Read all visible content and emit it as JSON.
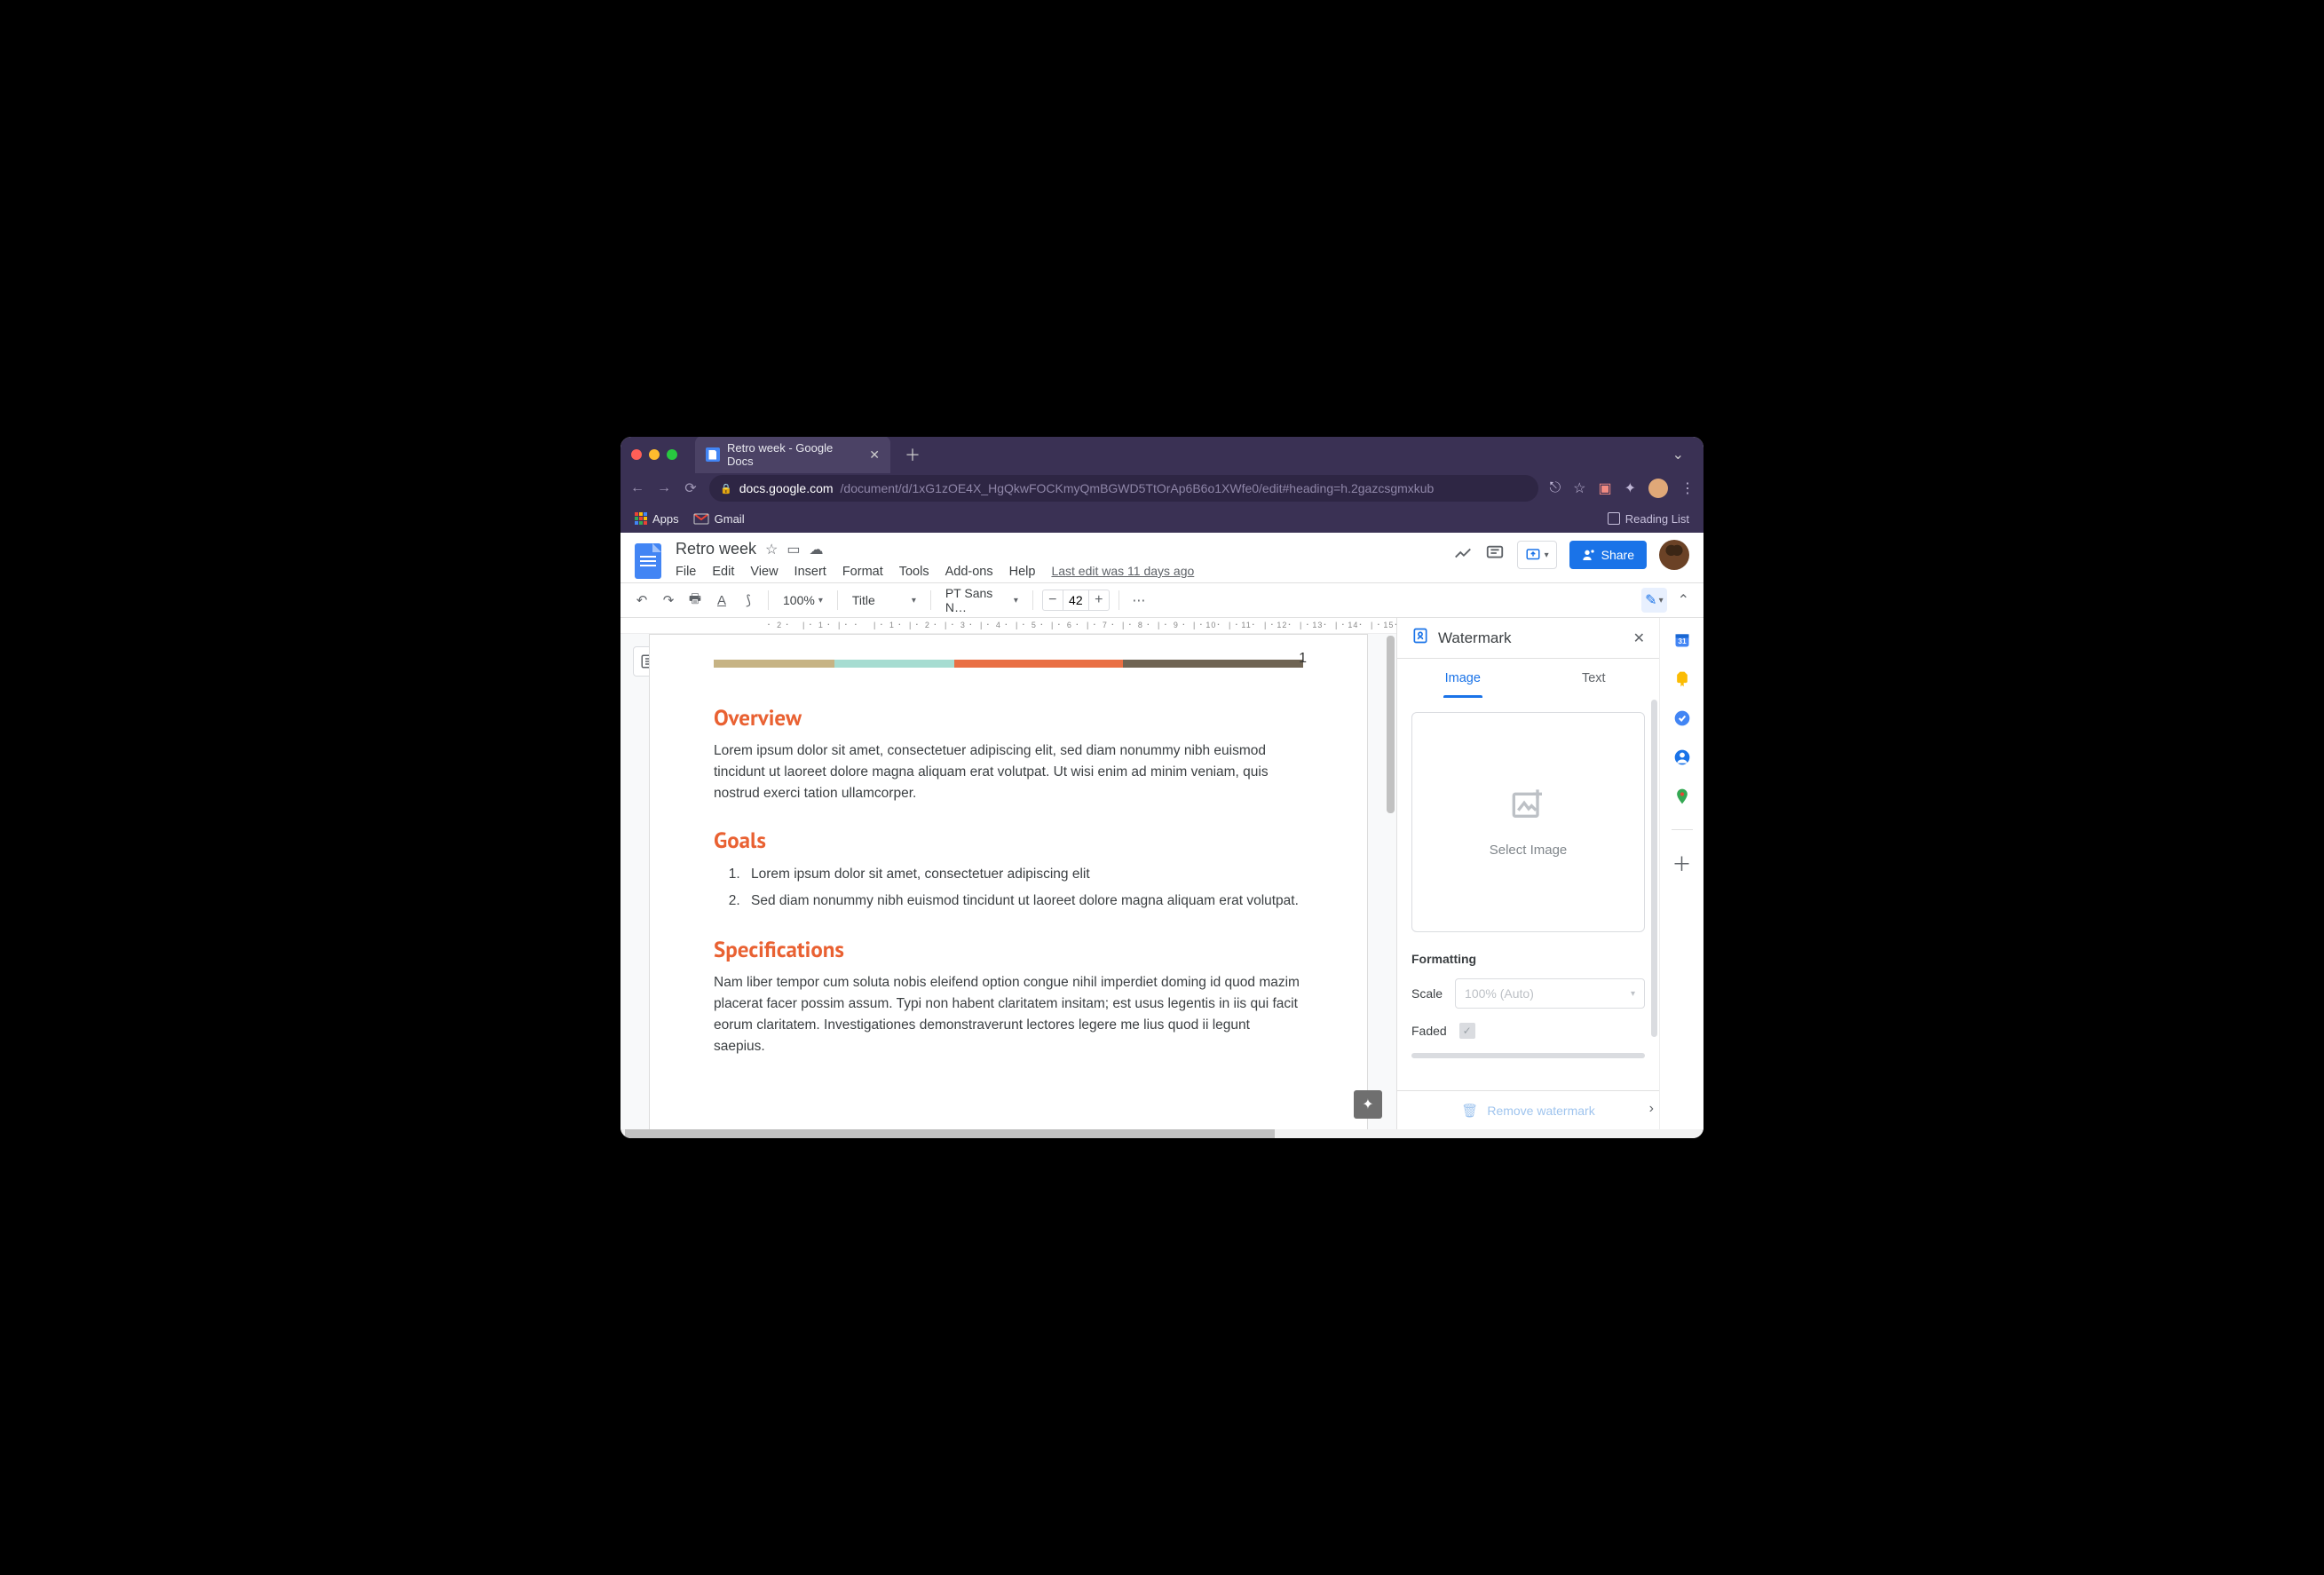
{
  "browser": {
    "tab_title": "Retro week - Google Docs",
    "url_host": "docs.google.com",
    "url_path": "/document/d/1xG1zOE4X_HgQkwFOCKmyQmBGWD5TtOrAp6B6o1XWfe0/edit#heading=h.2gazcsgmxkub",
    "bookmarks": {
      "apps": "Apps",
      "gmail": "Gmail",
      "reading_list": "Reading List"
    }
  },
  "docs": {
    "title": "Retro week",
    "menus": [
      "File",
      "Edit",
      "View",
      "Insert",
      "Format",
      "Tools",
      "Add-ons",
      "Help"
    ],
    "last_edit": "Last edit was 11 days ago",
    "share_label": "Share"
  },
  "toolbar": {
    "zoom": "100%",
    "style": "Title",
    "font": "PT Sans N…",
    "font_size": "42"
  },
  "document": {
    "page_number": "1",
    "sections": [
      {
        "heading": "Overview",
        "paragraph": "Lorem ipsum dolor sit amet, consectetuer adipiscing elit, sed diam nonummy nibh euismod tincidunt ut laoreet dolore magna aliquam erat volutpat. Ut wisi enim ad minim veniam, quis nostrud exerci tation ullamcorper."
      },
      {
        "heading": "Goals",
        "list": [
          "Lorem ipsum dolor sit amet, consectetuer adipiscing elit",
          "Sed diam nonummy nibh euismod tincidunt ut laoreet dolore magna aliquam erat volutpat."
        ]
      },
      {
        "heading": "Specifications",
        "paragraph": "Nam liber tempor cum soluta nobis eleifend option congue nihil imperdiet doming id quod mazim placerat facer possim assum. Typi non habent claritatem insitam; est usus legentis in iis qui facit eorum claritatem. Investigationes demonstraverunt lectores legere me lius quod ii legunt saepius."
      }
    ]
  },
  "watermark_panel": {
    "title": "Watermark",
    "tabs": {
      "image": "Image",
      "text": "Text"
    },
    "select_image": "Select Image",
    "formatting": "Formatting",
    "scale_label": "Scale",
    "scale_value": "100% (Auto)",
    "faded_label": "Faded",
    "remove": "Remove watermark"
  }
}
